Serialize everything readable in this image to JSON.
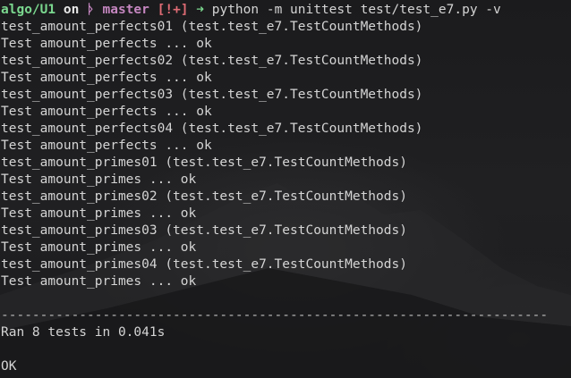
{
  "prompt": {
    "directory": "algo/U1",
    "on_text": "on",
    "git_icon": "ᚦ",
    "branch": "master",
    "status": "[!+]",
    "arrow": "➜",
    "command": "python -m unittest test/test_e7.py -v"
  },
  "test_lines": [
    "test_amount_perfects01 (test.test_e7.TestCountMethods)",
    "Test amount_perfects ... ok",
    "test_amount_perfects02 (test.test_e7.TestCountMethods)",
    "Test amount_perfects ... ok",
    "test_amount_perfects03 (test.test_e7.TestCountMethods)",
    "Test amount_perfects ... ok",
    "test_amount_perfects04 (test.test_e7.TestCountMethods)",
    "Test amount_perfects ... ok",
    "test_amount_primes01 (test.test_e7.TestCountMethods)",
    "Test amount_primes ... ok",
    "test_amount_primes02 (test.test_e7.TestCountMethods)",
    "Test amount_primes ... ok",
    "test_amount_primes03 (test.test_e7.TestCountMethods)",
    "Test amount_primes ... ok",
    "test_amount_primes04 (test.test_e7.TestCountMethods)",
    "Test amount_primes ... ok"
  ],
  "separator": "----------------------------------------------------------------------",
  "summary": "Ran 8 tests in 0.041s",
  "result": "OK",
  "colors": {
    "background": "#1c1c1e",
    "text": "#d4d4d4",
    "directory": "#7bd88f",
    "branch": "#c586c0",
    "status": "#e06c75"
  }
}
